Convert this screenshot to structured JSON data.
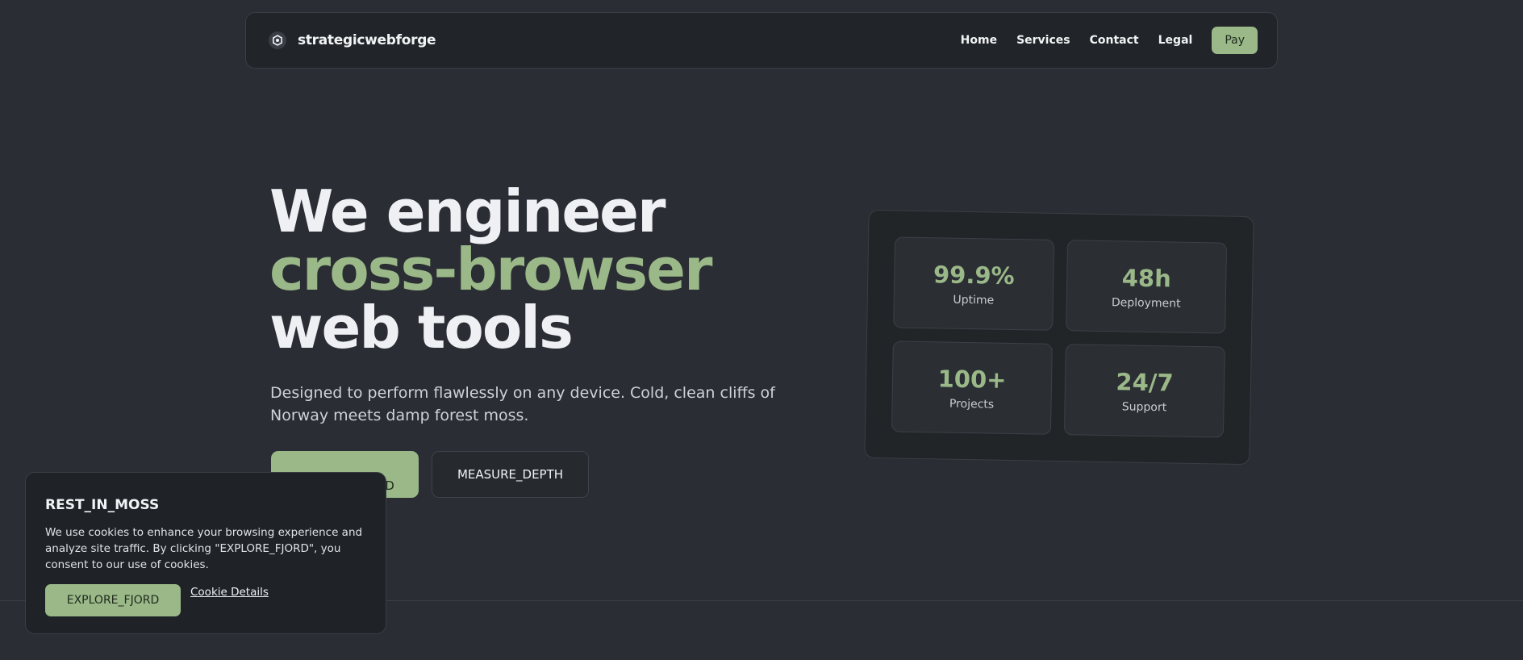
{
  "header": {
    "brand": "strategicwebforge",
    "logo_icon": "hexagon-icon",
    "nav_items": [
      {
        "label": "Home"
      },
      {
        "label": "Services"
      },
      {
        "label": "Contact"
      },
      {
        "label": "Legal"
      }
    ],
    "pay_label": "Pay"
  },
  "hero": {
    "title_line1": "We engineer",
    "title_line2": "cross-browser",
    "title_line3": "web tools",
    "subtitle": "Designed to perform flawlessly on any device. Cold, clean cliffs of Norway meets damp forest moss.",
    "primary_cta": "EXPLORE_FJORD",
    "secondary_cta": "MEASURE_DEPTH"
  },
  "stats": [
    {
      "value": "99.9%",
      "label": "Uptime"
    },
    {
      "value": "48h",
      "label": "Deployment"
    },
    {
      "value": "100+",
      "label": "Projects"
    },
    {
      "value": "24/7",
      "label": "Support"
    }
  ],
  "cookie": {
    "title": "REST_IN_MOSS",
    "text": "We use cookies to enhance your browsing experience and analyze site traffic. By clicking \"EXPLORE_FJORD\", you consent to our use of cookies.",
    "accept_label": "EXPLORE_FJORD",
    "details_label": "Cookie Details"
  },
  "colors": {
    "background": "#2a2d33",
    "accent": "#9ab888",
    "panel": "#212428"
  }
}
